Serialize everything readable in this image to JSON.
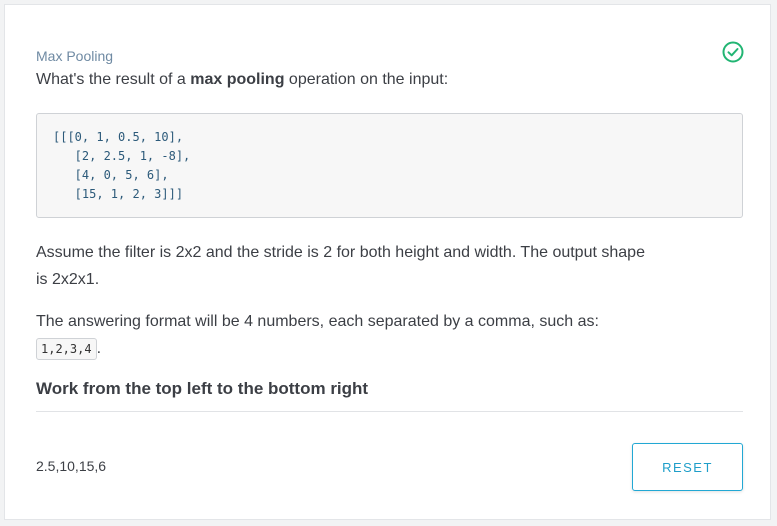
{
  "quiz": {
    "label": "Max Pooling",
    "question_prefix": "What's the result of a ",
    "question_bold": "max pooling",
    "question_suffix": " operation on the input:",
    "code": "[[[0, 1, 0.5, 10],\n   [2, 2.5, 1, -8],\n   [4, 0, 5, 6],\n   [15, 1, 2, 3]]]",
    "assumption": "Assume the filter is 2x2 and the stride is 2 for both height and width. The output shape is 2x2x1.",
    "format_text": "The answering format will be 4 numbers, each separated by a comma, such as: ",
    "format_example": "1,2,3,4",
    "format_end": ".",
    "hint": "Work from the top left to the bottom right",
    "answer": "2.5,10,15,6",
    "reset_label": "RESET",
    "status_icon": "check-circle-icon",
    "colors": {
      "accent": "#1e9ec9",
      "success": "#22b573",
      "label": "#6f8aa3"
    }
  }
}
